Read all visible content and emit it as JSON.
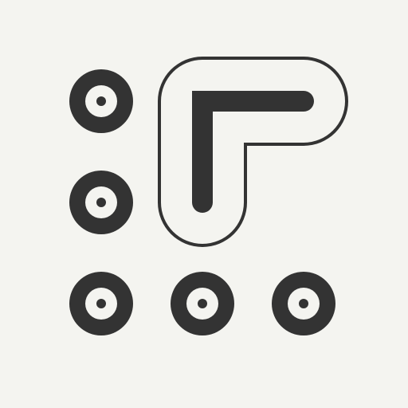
{
  "icon": {
    "name": "pattern-lock-icon",
    "colors": {
      "background": "#f4f4f0",
      "foreground": "#333333"
    },
    "grid": {
      "columns": 3,
      "rows": 3,
      "visible_dots": 5,
      "traced_path_dots": 4
    }
  }
}
